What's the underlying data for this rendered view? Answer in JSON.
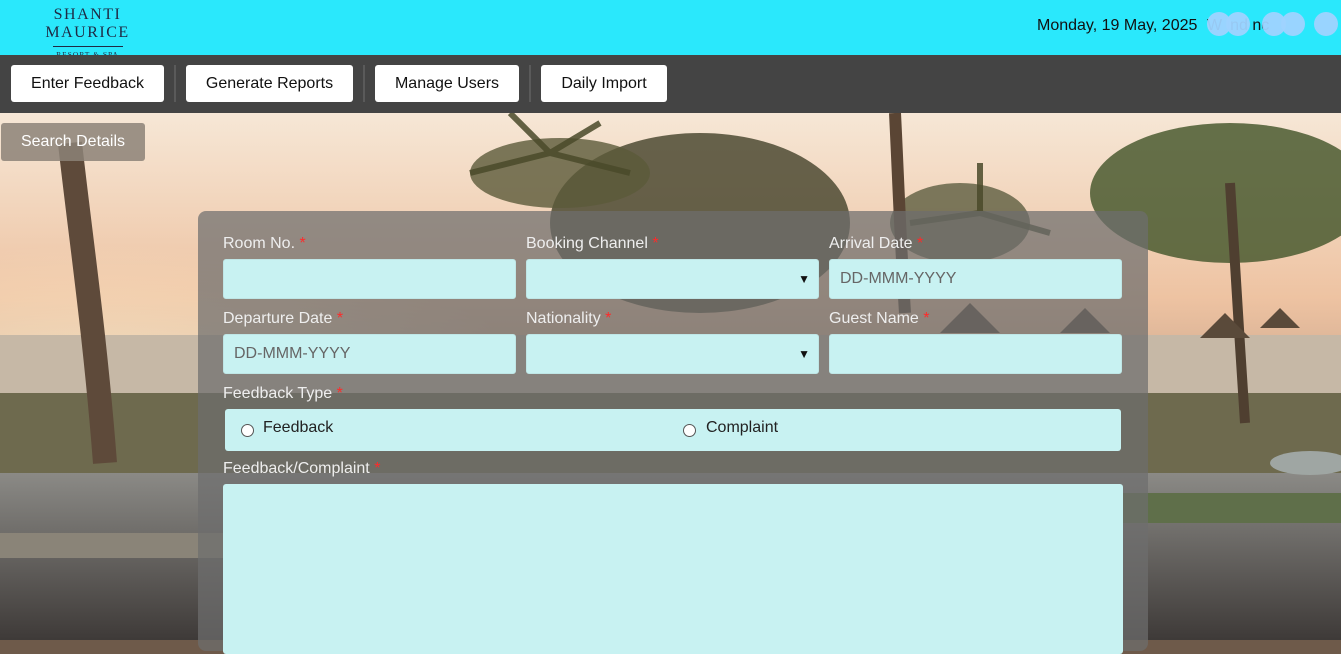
{
  "header": {
    "logo_main": "SHANTI MAURICE",
    "logo_sub": "RESORT & SPA",
    "date": "Monday, 19 May, 2025",
    "user_name_partial": "W   ind    nc"
  },
  "nav": {
    "enter_feedback": "Enter Feedback",
    "generate_reports": "Generate Reports",
    "manage_users": "Manage Users",
    "daily_import": "Daily Import"
  },
  "search": {
    "label": "Search Details"
  },
  "form": {
    "room_no": {
      "label": "Room No.",
      "required": "*",
      "value": ""
    },
    "booking_channel": {
      "label": "Booking Channel",
      "required": "*",
      "value": ""
    },
    "arrival_date": {
      "label": "Arrival Date",
      "required": "*",
      "placeholder": "DD-MMM-YYYY"
    },
    "departure_date": {
      "label": "Departure Date",
      "required": "*",
      "placeholder": "DD-MMM-YYYY"
    },
    "nationality": {
      "label": "Nationality",
      "required": "*",
      "value": ""
    },
    "guest_name": {
      "label": "Guest Name",
      "required": "*",
      "value": ""
    },
    "feedback_type": {
      "label": "Feedback Type",
      "required": "*",
      "options": [
        "Feedback",
        "Complaint"
      ],
      "selected": null
    },
    "feedback_complaint": {
      "label": "Feedback/Complaint",
      "required": "*",
      "value": ""
    }
  },
  "colors": {
    "header_bg": "#2ae8fc",
    "nav_bg": "#444444",
    "field_bg": "#c8f2f2",
    "required": "#ff2a2a"
  },
  "icons": [
    "select-chevron-down-icon",
    "radio-icon"
  ]
}
